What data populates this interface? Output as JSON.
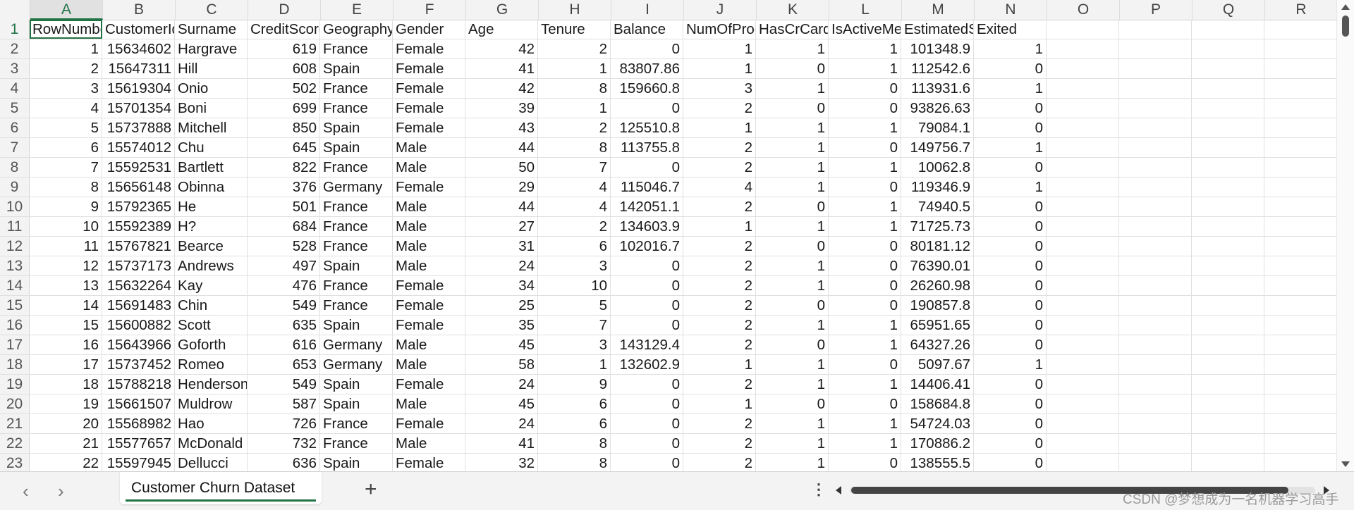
{
  "columns": [
    "A",
    "B",
    "C",
    "D",
    "E",
    "F",
    "G",
    "H",
    "I",
    "J",
    "K",
    "L",
    "M",
    "N",
    "O",
    "P",
    "Q",
    "R"
  ],
  "header_row": [
    "RowNumber",
    "CustomerId",
    "Surname",
    "CreditScore",
    "Geography",
    "Gender",
    "Age",
    "Tenure",
    "Balance",
    "NumOfProducts",
    "HasCrCard",
    "IsActiveMember",
    "EstimatedSalary",
    "Exited"
  ],
  "rows": [
    [
      "1",
      "15634602",
      "Hargrave",
      "619",
      "France",
      "Female",
      "42",
      "2",
      "0",
      "1",
      "1",
      "1",
      "101348.9",
      "1"
    ],
    [
      "2",
      "15647311",
      "Hill",
      "608",
      "Spain",
      "Female",
      "41",
      "1",
      "83807.86",
      "1",
      "0",
      "1",
      "112542.6",
      "0"
    ],
    [
      "3",
      "15619304",
      "Onio",
      "502",
      "France",
      "Female",
      "42",
      "8",
      "159660.8",
      "3",
      "1",
      "0",
      "113931.6",
      "1"
    ],
    [
      "4",
      "15701354",
      "Boni",
      "699",
      "France",
      "Female",
      "39",
      "1",
      "0",
      "2",
      "0",
      "0",
      "93826.63",
      "0"
    ],
    [
      "5",
      "15737888",
      "Mitchell",
      "850",
      "Spain",
      "Female",
      "43",
      "2",
      "125510.8",
      "1",
      "1",
      "1",
      "79084.1",
      "0"
    ],
    [
      "6",
      "15574012",
      "Chu",
      "645",
      "Spain",
      "Male",
      "44",
      "8",
      "113755.8",
      "2",
      "1",
      "0",
      "149756.7",
      "1"
    ],
    [
      "7",
      "15592531",
      "Bartlett",
      "822",
      "France",
      "Male",
      "50",
      "7",
      "0",
      "2",
      "1",
      "1",
      "10062.8",
      "0"
    ],
    [
      "8",
      "15656148",
      "Obinna",
      "376",
      "Germany",
      "Female",
      "29",
      "4",
      "115046.7",
      "4",
      "1",
      "0",
      "119346.9",
      "1"
    ],
    [
      "9",
      "15792365",
      "He",
      "501",
      "France",
      "Male",
      "44",
      "4",
      "142051.1",
      "2",
      "0",
      "1",
      "74940.5",
      "0"
    ],
    [
      "10",
      "15592389",
      "H?",
      "684",
      "France",
      "Male",
      "27",
      "2",
      "134603.9",
      "1",
      "1",
      "1",
      "71725.73",
      "0"
    ],
    [
      "11",
      "15767821",
      "Bearce",
      "528",
      "France",
      "Male",
      "31",
      "6",
      "102016.7",
      "2",
      "0",
      "0",
      "80181.12",
      "0"
    ],
    [
      "12",
      "15737173",
      "Andrews",
      "497",
      "Spain",
      "Male",
      "24",
      "3",
      "0",
      "2",
      "1",
      "0",
      "76390.01",
      "0"
    ],
    [
      "13",
      "15632264",
      "Kay",
      "476",
      "France",
      "Female",
      "34",
      "10",
      "0",
      "2",
      "1",
      "0",
      "26260.98",
      "0"
    ],
    [
      "14",
      "15691483",
      "Chin",
      "549",
      "France",
      "Female",
      "25",
      "5",
      "0",
      "2",
      "0",
      "0",
      "190857.8",
      "0"
    ],
    [
      "15",
      "15600882",
      "Scott",
      "635",
      "Spain",
      "Female",
      "35",
      "7",
      "0",
      "2",
      "1",
      "1",
      "65951.65",
      "0"
    ],
    [
      "16",
      "15643966",
      "Goforth",
      "616",
      "Germany",
      "Male",
      "45",
      "3",
      "143129.4",
      "2",
      "0",
      "1",
      "64327.26",
      "0"
    ],
    [
      "17",
      "15737452",
      "Romeo",
      "653",
      "Germany",
      "Male",
      "58",
      "1",
      "132602.9",
      "1",
      "1",
      "0",
      "5097.67",
      "1"
    ],
    [
      "18",
      "15788218",
      "Henderson",
      "549",
      "Spain",
      "Female",
      "24",
      "9",
      "0",
      "2",
      "1",
      "1",
      "14406.41",
      "0"
    ],
    [
      "19",
      "15661507",
      "Muldrow",
      "587",
      "Spain",
      "Male",
      "45",
      "6",
      "0",
      "1",
      "0",
      "0",
      "158684.8",
      "0"
    ],
    [
      "20",
      "15568982",
      "Hao",
      "726",
      "France",
      "Female",
      "24",
      "6",
      "0",
      "2",
      "1",
      "1",
      "54724.03",
      "0"
    ],
    [
      "21",
      "15577657",
      "McDonald",
      "732",
      "France",
      "Male",
      "41",
      "8",
      "0",
      "2",
      "1",
      "1",
      "170886.2",
      "0"
    ],
    [
      "22",
      "15597945",
      "Dellucci",
      "636",
      "Spain",
      "Female",
      "32",
      "8",
      "0",
      "2",
      "1",
      "0",
      "138555.5",
      "0"
    ]
  ],
  "text_columns": [
    2,
    4,
    5
  ],
  "sheet_tab": "Customer Churn Dataset",
  "nav": {
    "prev": "‹",
    "next": "›",
    "add": "+",
    "more": "⋮"
  },
  "watermark": "CSDN @梦想成为一名机器学习高手",
  "selected_cell": "A1",
  "colors": {
    "accent": "#217346",
    "header_bg": "#f3f3f3",
    "grid": "#e0e0e0"
  }
}
